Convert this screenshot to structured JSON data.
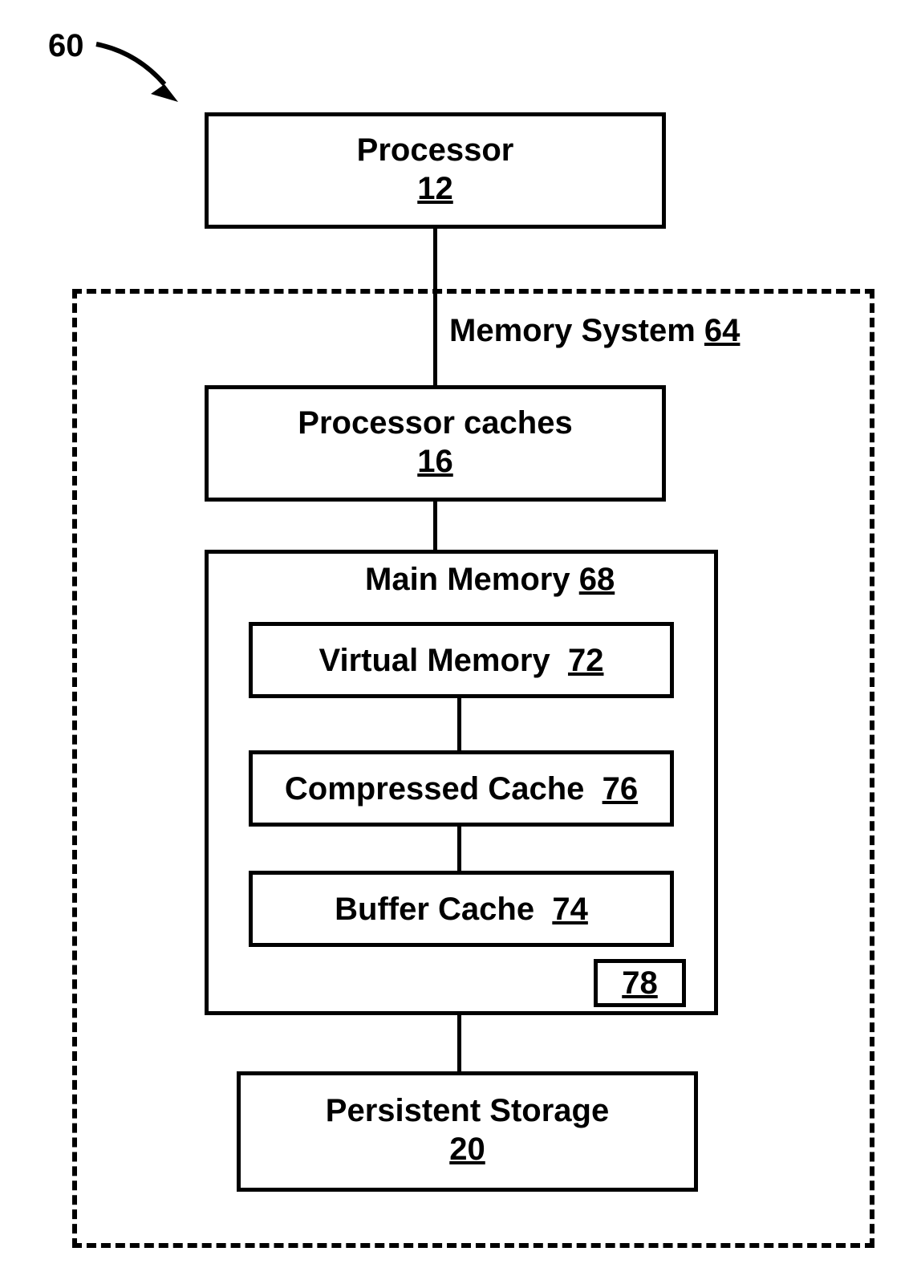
{
  "figure_ref": "60",
  "processor": {
    "label": "Processor",
    "num": "12"
  },
  "memory_system": {
    "label": "Memory System",
    "num": "64"
  },
  "processor_caches": {
    "label": "Processor caches",
    "num": "16"
  },
  "main_memory": {
    "label": "Main Memory",
    "num": "68"
  },
  "virtual_memory": {
    "label": "Virtual Memory",
    "num": "72"
  },
  "compressed_cache": {
    "label": "Compressed Cache",
    "num": "76"
  },
  "buffer_cache": {
    "label": "Buffer Cache",
    "num": "74"
  },
  "small_block": {
    "num": "78"
  },
  "persistent_storage": {
    "label": "Persistent Storage",
    "num": "20"
  }
}
